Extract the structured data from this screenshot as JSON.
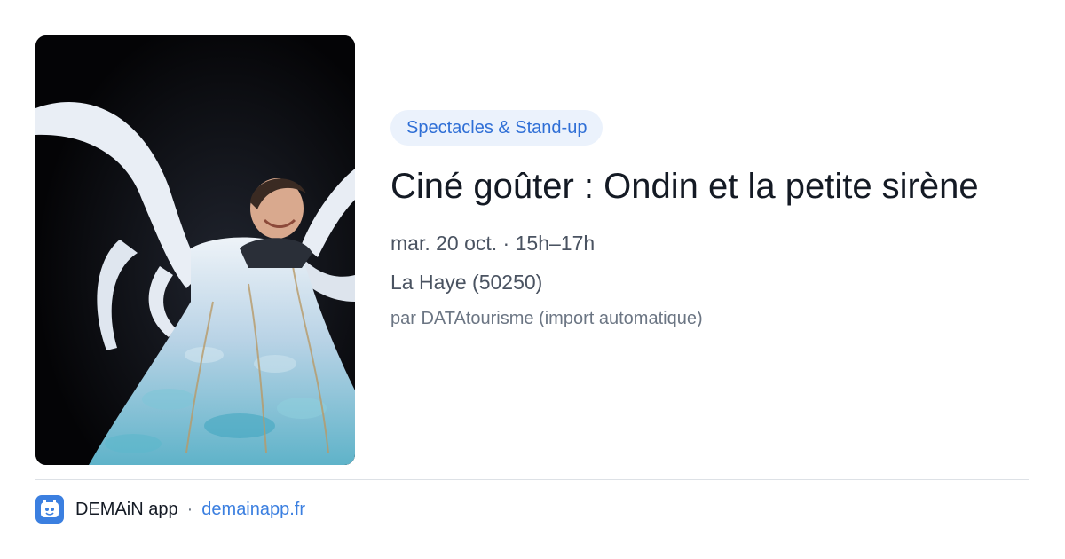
{
  "event": {
    "category": "Spectacles & Stand-up",
    "title": "Ciné goûter : Ondin et la petite sirène",
    "datetime": "mar. 20 oct. · 15h–17h",
    "location": "La Haye (50250)",
    "source": "par DATAtourisme (import automatique)"
  },
  "footer": {
    "app_name": "DEMAiN app",
    "separator": "·",
    "site": "demainapp.fr"
  },
  "icons": {
    "app": "demain-app-logo-icon"
  },
  "colors": {
    "accent": "#3b7fe0",
    "badge_bg": "#ebf2fc",
    "badge_text": "#2f6fd6",
    "title": "#141a24",
    "meta": "#4a5361",
    "muted": "#6b7583"
  }
}
